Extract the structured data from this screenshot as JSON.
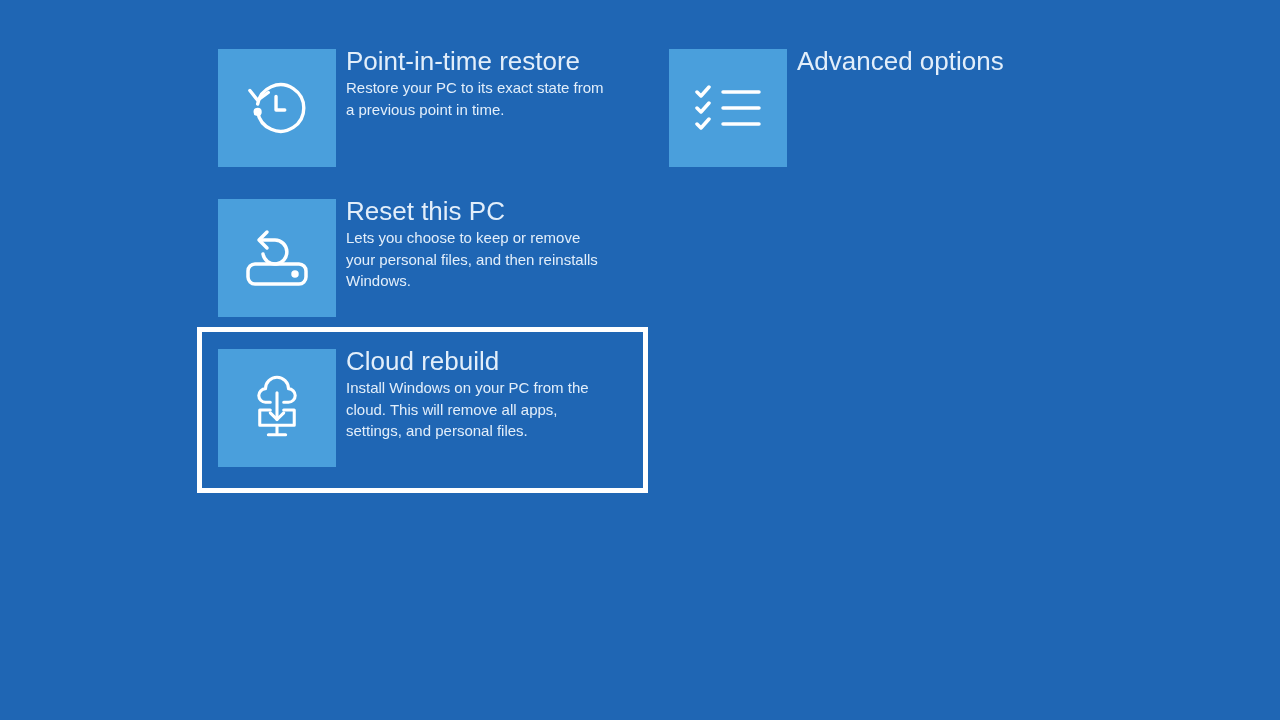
{
  "options": [
    {
      "kind": "history",
      "title": "Point-in-time restore",
      "description": "Restore your PC to its exact state from a previous point in time.",
      "selected": false
    },
    {
      "kind": "reset",
      "title": "Reset this PC",
      "description": "Lets you choose to keep or remove your personal files, and then reinstalls Windows.",
      "selected": false
    },
    {
      "kind": "cloud",
      "title": "Cloud rebuild",
      "description": "Install Windows on your PC from the cloud. This will remove all apps, settings, and personal files.",
      "selected": true
    },
    {
      "kind": "checklist",
      "title": "Advanced options",
      "selected": false
    }
  ]
}
